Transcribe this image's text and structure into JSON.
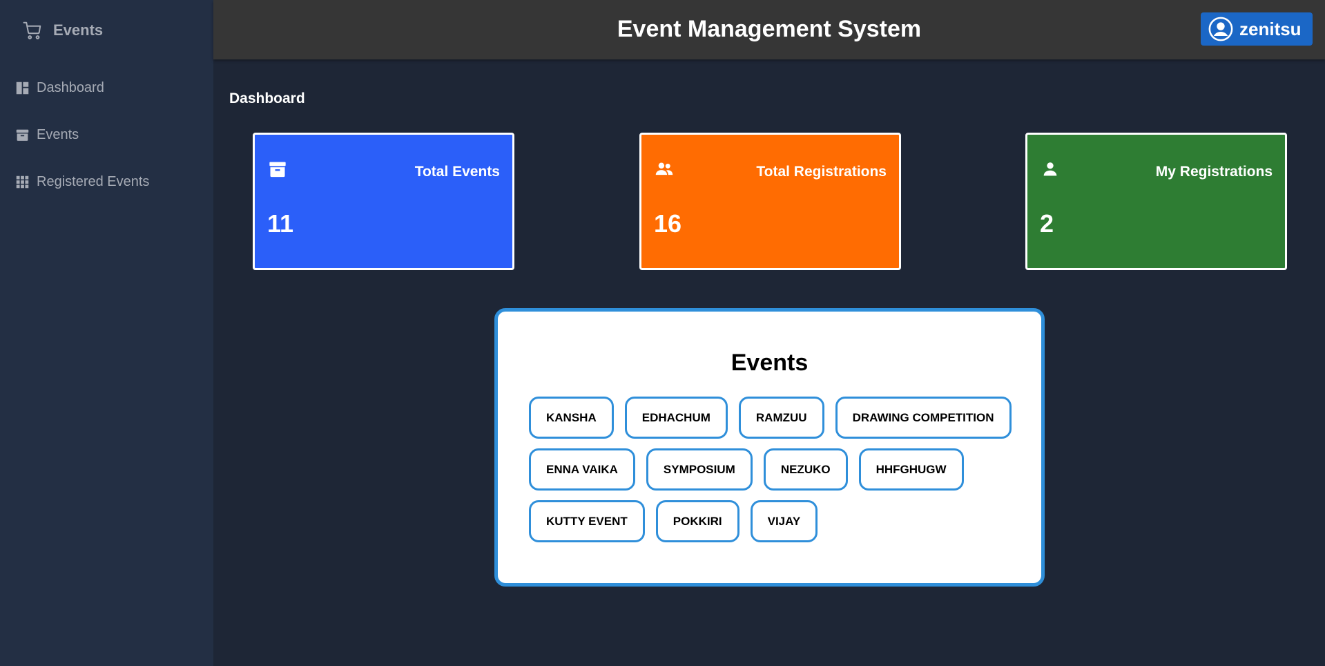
{
  "sidebar": {
    "brand": {
      "label": "Events",
      "icon": "cart-icon"
    },
    "items": [
      {
        "label": "Dashboard",
        "icon": "dashboard-icon"
      },
      {
        "label": "Events",
        "icon": "archive-icon"
      },
      {
        "label": "Registered Events",
        "icon": "grid-icon"
      }
    ]
  },
  "header": {
    "title": "Event Management System",
    "user": {
      "name": "zenitsu",
      "icon": "user-circle-icon"
    }
  },
  "main": {
    "section_title": "Dashboard",
    "stats": [
      {
        "label": "Total Events",
        "value": "11",
        "color": "#2b5ff9",
        "icon": "archive-icon"
      },
      {
        "label": "Total Registrations",
        "value": "16",
        "color": "#ff6c02",
        "icon": "users-icon"
      },
      {
        "label": "My Registrations",
        "value": "2",
        "color": "#2e7d33",
        "icon": "user-icon"
      }
    ],
    "events_panel": {
      "title": "Events",
      "events": [
        "KANSHA",
        "EDHACHUM",
        "RAMZUU",
        "DRAWING COMPETITION",
        "ENNA VAIKA",
        "SYMPOSIUM",
        "NEZUKO",
        "HHFGHUGW",
        "KUTTY EVENT",
        "POKKIRI",
        "VIJAY"
      ]
    }
  },
  "colors": {
    "background": "#1e2636",
    "sidebar": "#232f44",
    "topbar": "#363636",
    "accent": "#1b67c6",
    "chip_border": "#2f8fda"
  }
}
